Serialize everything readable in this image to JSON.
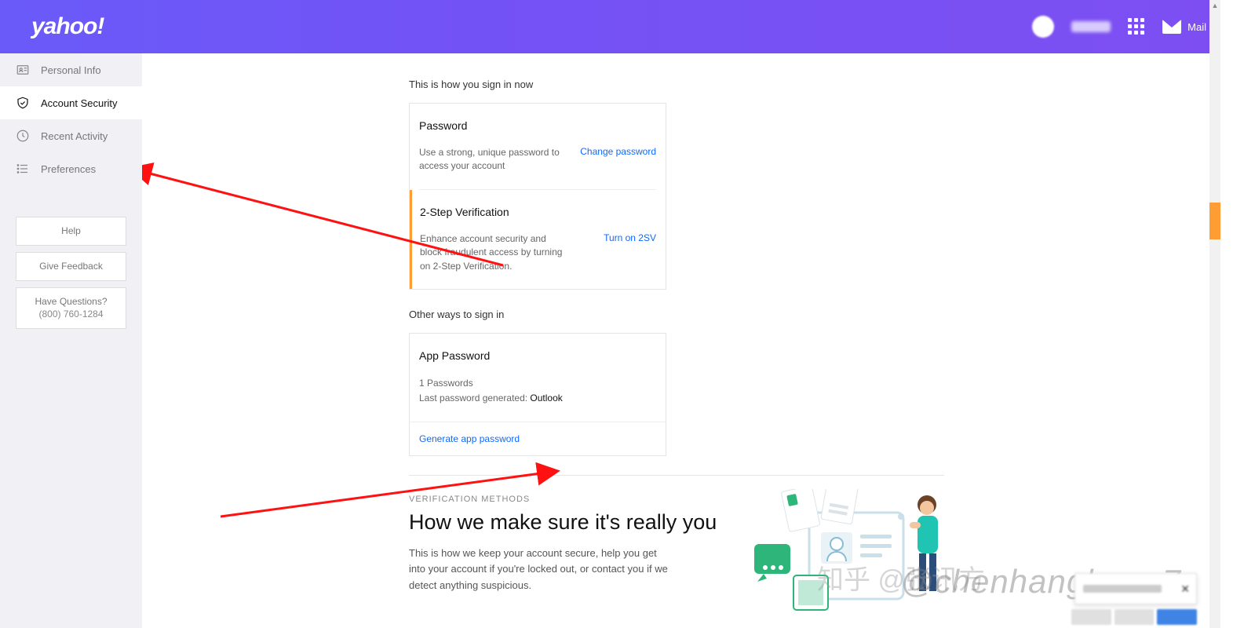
{
  "header": {
    "logo": "yahoo!",
    "mail_label": "Mail"
  },
  "sidebar": {
    "items": [
      {
        "label": "Personal Info"
      },
      {
        "label": "Account Security"
      },
      {
        "label": "Recent Activity"
      },
      {
        "label": "Preferences"
      }
    ],
    "help": "Help",
    "feedback": "Give Feedback",
    "questions": "Have Questions?",
    "phone": "(800) 760-1284"
  },
  "signin": {
    "heading": "This is how you sign in now",
    "password": {
      "title": "Password",
      "desc": "Use a strong, unique password to access your account",
      "link": "Change password"
    },
    "twostep": {
      "title": "2-Step Verification",
      "desc": "Enhance account security and block fraudulent access by turning on 2-Step Verification.",
      "link": "Turn on 2SV"
    }
  },
  "other": {
    "heading": "Other ways to sign in",
    "app": {
      "title": "App Password",
      "count": "1 Passwords",
      "last_prefix": "Last password generated: ",
      "last_name": "Outlook",
      "gen": "Generate app password"
    }
  },
  "verif": {
    "eyebrow": "VERIFICATION METHODS",
    "title": "How we make sure it's really you",
    "body": "This is how we keep your account secure, help you get into your account if you're locked out, or contact you if we detect anything suspicious."
  },
  "watermark": {
    "en": "@chenhanghang7",
    "zh": "知乎 @张讯方"
  }
}
